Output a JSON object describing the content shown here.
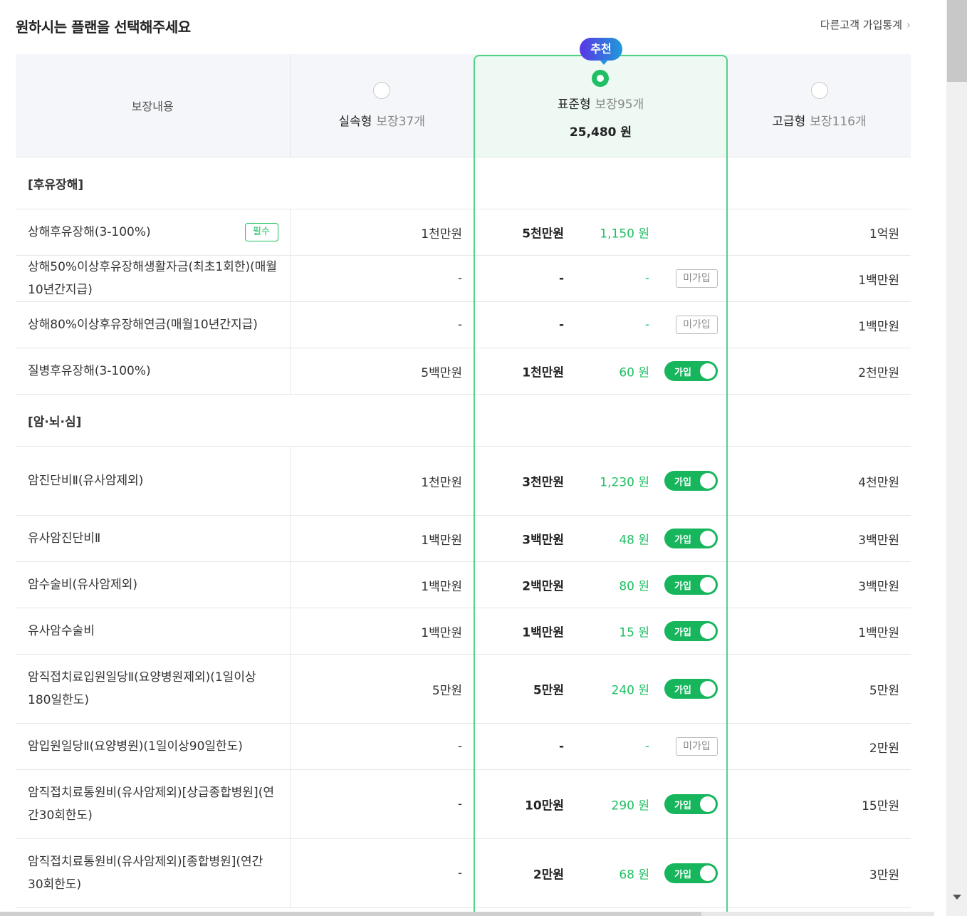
{
  "header": {
    "title": "원하시는 플랜을 선택해주세요",
    "stats_link": "다른고객 가입통계",
    "stats_chevron": "›"
  },
  "columns": {
    "name_header": "보장내용",
    "basic": {
      "name": "실속형",
      "count": "보장37개"
    },
    "standard": {
      "name": "표준형",
      "count": "보장95개",
      "price": "25,480 원",
      "badge": "추천"
    },
    "advanced": {
      "name": "고급형",
      "count": "보장116개"
    }
  },
  "labels": {
    "required": "필수",
    "joined": "가입",
    "not_joined": "미가입"
  },
  "sections": [
    {
      "title": "[후유장해]",
      "rows": [
        {
          "name": "상해후유장해(3-100%)",
          "required": true,
          "basic": "1천만원",
          "std": "5천만원",
          "premium": "1,150 원",
          "status": "none",
          "adv": "1억원"
        },
        {
          "name": "상해50%이상후유장해생활자금(최초1회한)(매월10년간지급)",
          "basic": "-",
          "std": "-",
          "premium": "-",
          "status": "not_joined",
          "adv": "1백만원"
        },
        {
          "name": "상해80%이상후유장해연금(매월10년간지급)",
          "basic": "-",
          "std": "-",
          "premium": "-",
          "status": "not_joined",
          "adv": "1백만원"
        },
        {
          "name": "질병후유장해(3-100%)",
          "basic": "5백만원",
          "std": "1천만원",
          "premium": "60 원",
          "status": "joined",
          "adv": "2천만원"
        }
      ]
    },
    {
      "title": "[암·뇌·심]",
      "rows": [
        {
          "name": "암진단비Ⅱ(유사암제외)",
          "basic": "1천만원",
          "std": "3천만원",
          "premium": "1,230 원",
          "status": "joined",
          "adv": "4천만원"
        },
        {
          "name": "유사암진단비Ⅱ",
          "basic": "1백만원",
          "std": "3백만원",
          "premium": "48 원",
          "status": "joined",
          "adv": "3백만원"
        },
        {
          "name": "암수술비(유사암제외)",
          "basic": "1백만원",
          "std": "2백만원",
          "premium": "80 원",
          "status": "joined",
          "adv": "3백만원"
        },
        {
          "name": "유사암수술비",
          "basic": "1백만원",
          "std": "1백만원",
          "premium": "15 원",
          "status": "joined",
          "adv": "1백만원"
        },
        {
          "name": "암직접치료입원일당Ⅱ(요양병원제외)(1일이상180일한도)",
          "basic": "5만원",
          "std": "5만원",
          "premium": "240 원",
          "status": "joined",
          "adv": "5만원"
        },
        {
          "name": "암입원일당Ⅱ(요양병원)(1일이상90일한도)",
          "basic": "-",
          "std": "-",
          "premium": "-",
          "status": "not_joined",
          "adv": "2만원"
        },
        {
          "name": "암직접치료통원비(유사암제외)[상급종합병원](연간30회한도)",
          "basic": "-",
          "std": "10만원",
          "premium": "290 원",
          "status": "joined",
          "adv": "15만원"
        },
        {
          "name": "암직접치료통원비(유사암제외)[종합병원](연간30회한도)",
          "basic": "-",
          "std": "2만원",
          "premium": "68 원",
          "status": "joined",
          "adv": "3만원"
        }
      ]
    }
  ]
}
